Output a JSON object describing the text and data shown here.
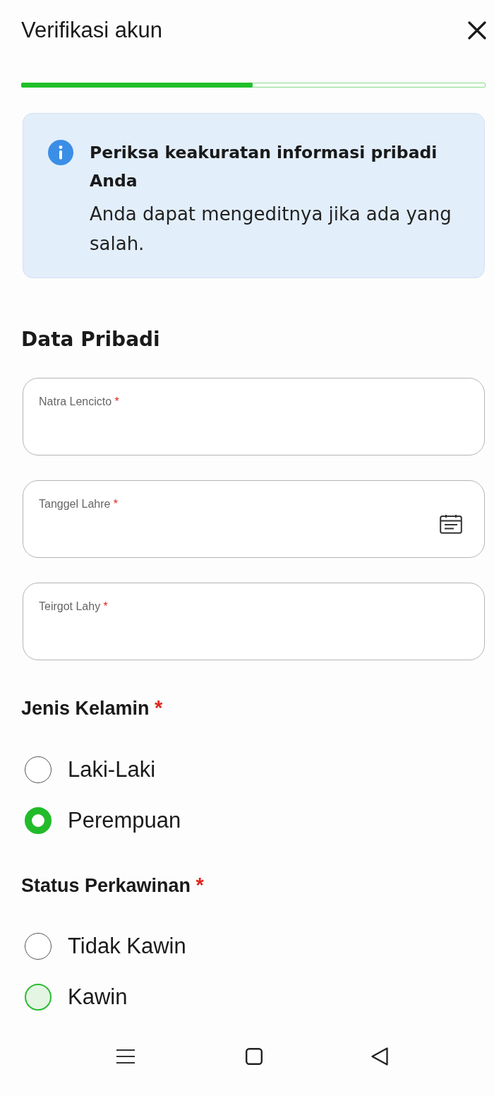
{
  "header": {
    "title": "Verifikasi akun"
  },
  "progress": {
    "level": 0.5
  },
  "info_card": {
    "title": "Periksa keakuratan informasi pribadi Anda",
    "body": "Anda dapat mengeditnya jika ada yang salah."
  },
  "section": {
    "title": "Data Pribadi"
  },
  "fields": [
    {
      "label": "Natra Lencicto",
      "required_mark": "*",
      "kind": "text"
    },
    {
      "label": "Tanggel Lahre",
      "required_mark": "*",
      "kind": "date"
    },
    {
      "label": "Teirgot Lahy",
      "required_mark": "*",
      "kind": "text"
    }
  ],
  "radio_groups": [
    {
      "title": "Jenis Kelamin",
      "required_mark": "*",
      "options": [
        {
          "label": "Laki-Laki",
          "selected": false,
          "focused": false
        },
        {
          "label": "Perempuan",
          "selected": true,
          "focused": false
        }
      ]
    },
    {
      "title": "Status Perkawinan",
      "required_mark": "*",
      "options": [
        {
          "label": "Tidak Kawin",
          "selected": false,
          "focused": false
        },
        {
          "label": "Kawin",
          "selected": false,
          "focused": true
        }
      ]
    }
  ]
}
